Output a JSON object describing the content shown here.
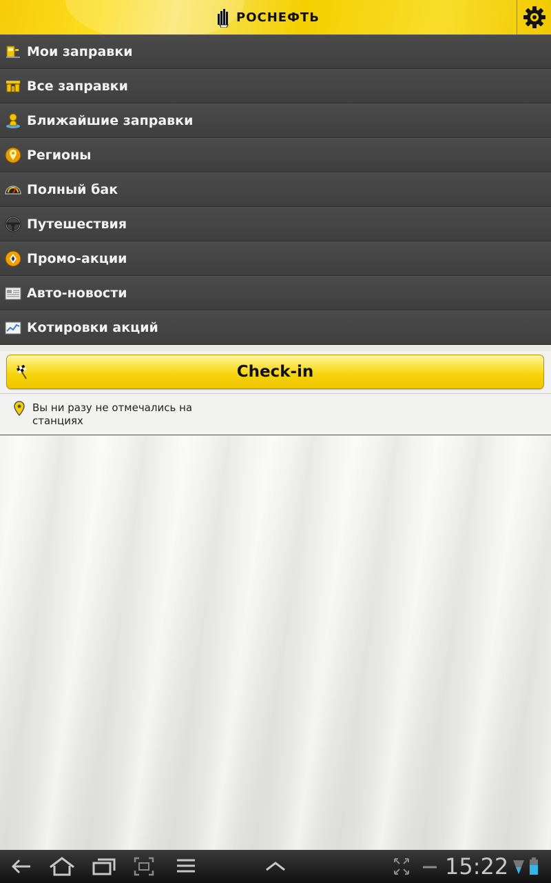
{
  "header": {
    "brand_name": "РОСНЕФТЬ",
    "colors": {
      "accent": "#f5d000",
      "menu_bg": "#444444"
    }
  },
  "menu": {
    "items": [
      {
        "label": "Мои заправки",
        "icon": "my-station-icon"
      },
      {
        "label": "Все заправки",
        "icon": "all-stations-icon"
      },
      {
        "label": "Ближайшие заправки",
        "icon": "nearby-pin-icon"
      },
      {
        "label": "Регионы",
        "icon": "regions-icon"
      },
      {
        "label": "Полный бак",
        "icon": "fuel-gauge-icon"
      },
      {
        "label": "Путешествия",
        "icon": "steering-wheel-icon"
      },
      {
        "label": "Промо-акции",
        "icon": "promo-icon"
      },
      {
        "label": "Авто-новости",
        "icon": "newspaper-icon"
      },
      {
        "label": "Котировки акций",
        "icon": "stock-chart-icon"
      }
    ]
  },
  "checkin": {
    "label": "Check-in"
  },
  "notice": {
    "text": "Вы ни разу не отмечались на станциях"
  },
  "status_bar": {
    "time": "15:22"
  }
}
